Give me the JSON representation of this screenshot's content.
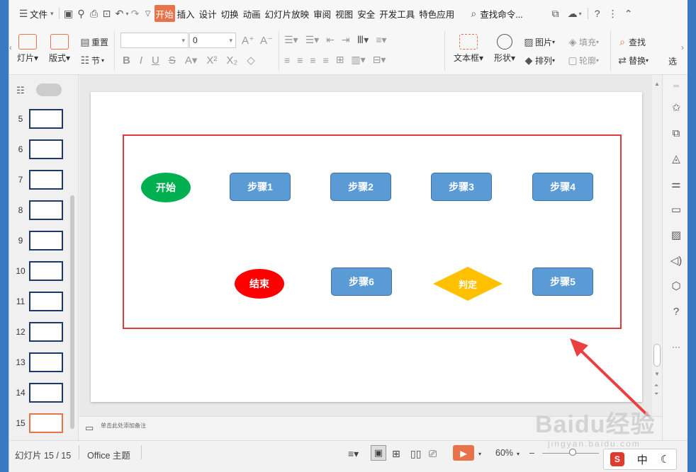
{
  "menubar": {
    "file": "文件",
    "tabs": [
      "开始",
      "插入",
      "设计",
      "切换",
      "动画",
      "幻灯片放映",
      "审阅",
      "视图",
      "安全",
      "开发工具",
      "特色应用"
    ],
    "active_tab": "开始",
    "search": "查找命令..."
  },
  "ribbon": {
    "new_slide": "灯片",
    "layout": "版式",
    "reset": "重置",
    "section": "节",
    "font_name": "",
    "font_size": "0",
    "textbox": "文本框",
    "shape": "形状",
    "picture": "图片",
    "fill": "填充",
    "arrange": "排列",
    "outline": "轮廓",
    "find": "查找",
    "replace": "替换",
    "select": "选"
  },
  "thumbnails": [
    {
      "num": "5"
    },
    {
      "num": "6"
    },
    {
      "num": "7"
    },
    {
      "num": "8"
    },
    {
      "num": "9"
    },
    {
      "num": "10"
    },
    {
      "num": "11"
    },
    {
      "num": "12"
    },
    {
      "num": "13"
    },
    {
      "num": "14"
    },
    {
      "num": "15",
      "selected": true
    }
  ],
  "slide": {
    "start": "开始",
    "end": "结束",
    "step1": "步骤1",
    "step2": "步骤2",
    "step3": "步骤3",
    "step4": "步骤4",
    "step5": "步骤5",
    "step6": "步骤6",
    "decision": "判定",
    "colors": {
      "start": "#00b050",
      "end": "#ff0000",
      "step": "#5b9bd5",
      "decision": "#ffc000",
      "highlight": "#e0393e"
    }
  },
  "notes": {
    "placeholder": "单击此处添加备注"
  },
  "status": {
    "slide_count": "幻灯片 15 / 15",
    "theme": "Office 主题",
    "zoom": "60%"
  },
  "ime": {
    "mode": "中"
  },
  "watermark": {
    "brand": "Baidu经验",
    "url": "jingyan.baidu.com"
  }
}
